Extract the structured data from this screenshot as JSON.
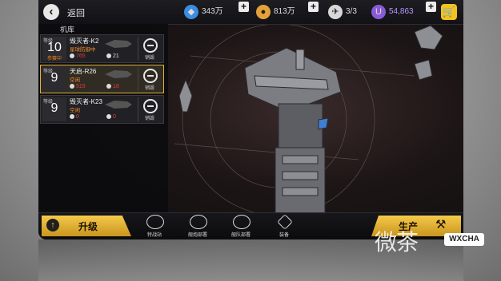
{
  "topbar": {
    "back_label": "返回",
    "resources": [
      {
        "icon": "crystal-icon",
        "value": "343万",
        "color": "#3a8de0"
      },
      {
        "icon": "metal-icon",
        "value": "813万",
        "color": "#e2a13b"
      },
      {
        "icon": "fleet-slot-icon",
        "value": "3/3",
        "color": "#d8d8d8"
      },
      {
        "icon": "premium-currency-icon",
        "value": "54,863",
        "color": "#8a5bd6"
      }
    ],
    "plus": "+",
    "cart_icon": "shopping-cart-icon"
  },
  "hangar": {
    "title": "机库",
    "level_tag": "等级",
    "sell_label": "销毁",
    "ships": [
      {
        "level": "10",
        "status": "参赛中",
        "name": "毁灭者-K2",
        "state": "星球防御中",
        "stat1": "765",
        "stat2": "21",
        "selected": false
      },
      {
        "level": "9",
        "status": "",
        "name": "天启-R26",
        "state": "空闲",
        "stat1": "515",
        "stat2": "18",
        "selected": true
      },
      {
        "level": "9",
        "status": "",
        "name": "毁灭者-K23",
        "state": "空闲",
        "stat1": "0",
        "stat2": "0",
        "selected": false
      }
    ]
  },
  "bottombar": {
    "upgrade_label": "升级",
    "produce_label": "生产",
    "tools": [
      {
        "label": "特战站",
        "icon": "helmet-icon"
      },
      {
        "label": "舰炮部署",
        "icon": "cannon-icon"
      },
      {
        "label": "舰队部署",
        "icon": "fleet-icon"
      },
      {
        "label": "装备",
        "icon": "gear-module-icon"
      }
    ]
  },
  "watermark": {
    "text": "微茶",
    "badge": "WXCHA"
  },
  "colors": {
    "accent": "#f4c94a",
    "alert": "#f07a1a",
    "red_stat": "#e23a3a"
  }
}
